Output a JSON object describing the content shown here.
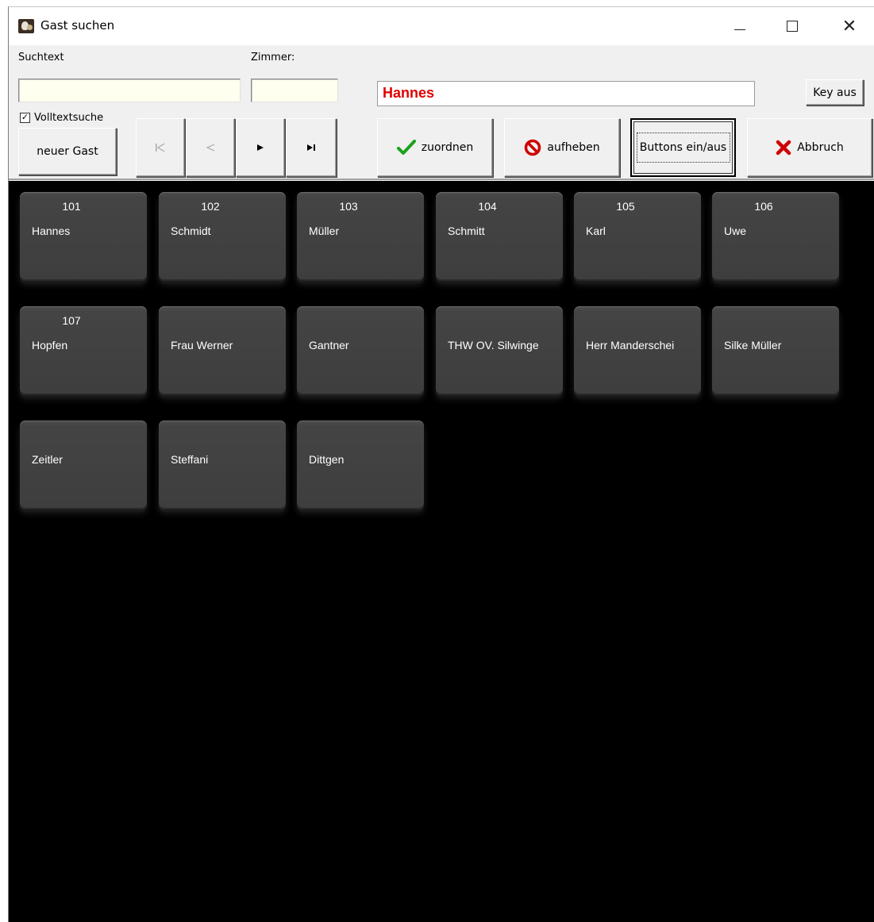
{
  "window": {
    "title": "Gast suchen",
    "controls": {
      "minimize": "minimize-icon",
      "maximize": "maximize-icon",
      "close": "close-icon"
    }
  },
  "toolbar": {
    "suchtext_label": "Suchtext",
    "suchtext_value": "",
    "zimmer_label": "Zimmer:",
    "zimmer_value": "",
    "selected_guest": "Hannes",
    "volltextsuche_label": "Volltextsuche",
    "volltextsuche_checked": true,
    "new_guest_label": "neuer Gast",
    "key_aus_label": "Key aus",
    "nav": {
      "first": "first-icon",
      "prev": "prev-icon",
      "next": "next-icon",
      "last": "last-icon"
    },
    "zuordnen_label": "zuordnen",
    "aufheben_label": "aufheben",
    "buttons_toggle_label": "Buttons ein/aus",
    "abbruch_label": "Abbruch"
  },
  "colors": {
    "selected_guest_text": "#e00000",
    "input_background": "#fffff0",
    "grid_background": "#000000",
    "tile_background": "#444444",
    "check_green": "#1aa21a",
    "cancel_red": "#d00000"
  },
  "guests": [
    {
      "room": "101",
      "name": "Hannes"
    },
    {
      "room": "102",
      "name": "Schmidt"
    },
    {
      "room": "103",
      "name": "Müller"
    },
    {
      "room": "104",
      "name": "Schmitt"
    },
    {
      "room": "105",
      "name": "Karl"
    },
    {
      "room": "106",
      "name": "Uwe"
    },
    {
      "room": "107",
      "name": "Hopfen"
    },
    {
      "room": "",
      "name": "Frau Werner"
    },
    {
      "room": "",
      "name": "Gantner"
    },
    {
      "room": "",
      "name": "THW OV. Silwinge"
    },
    {
      "room": "",
      "name": "Herr Manderschei"
    },
    {
      "room": "",
      "name": "Silke Müller"
    },
    {
      "room": "",
      "name": "Zeitler"
    },
    {
      "room": "",
      "name": "Steffani"
    },
    {
      "room": "",
      "name": "Dittgen"
    }
  ]
}
